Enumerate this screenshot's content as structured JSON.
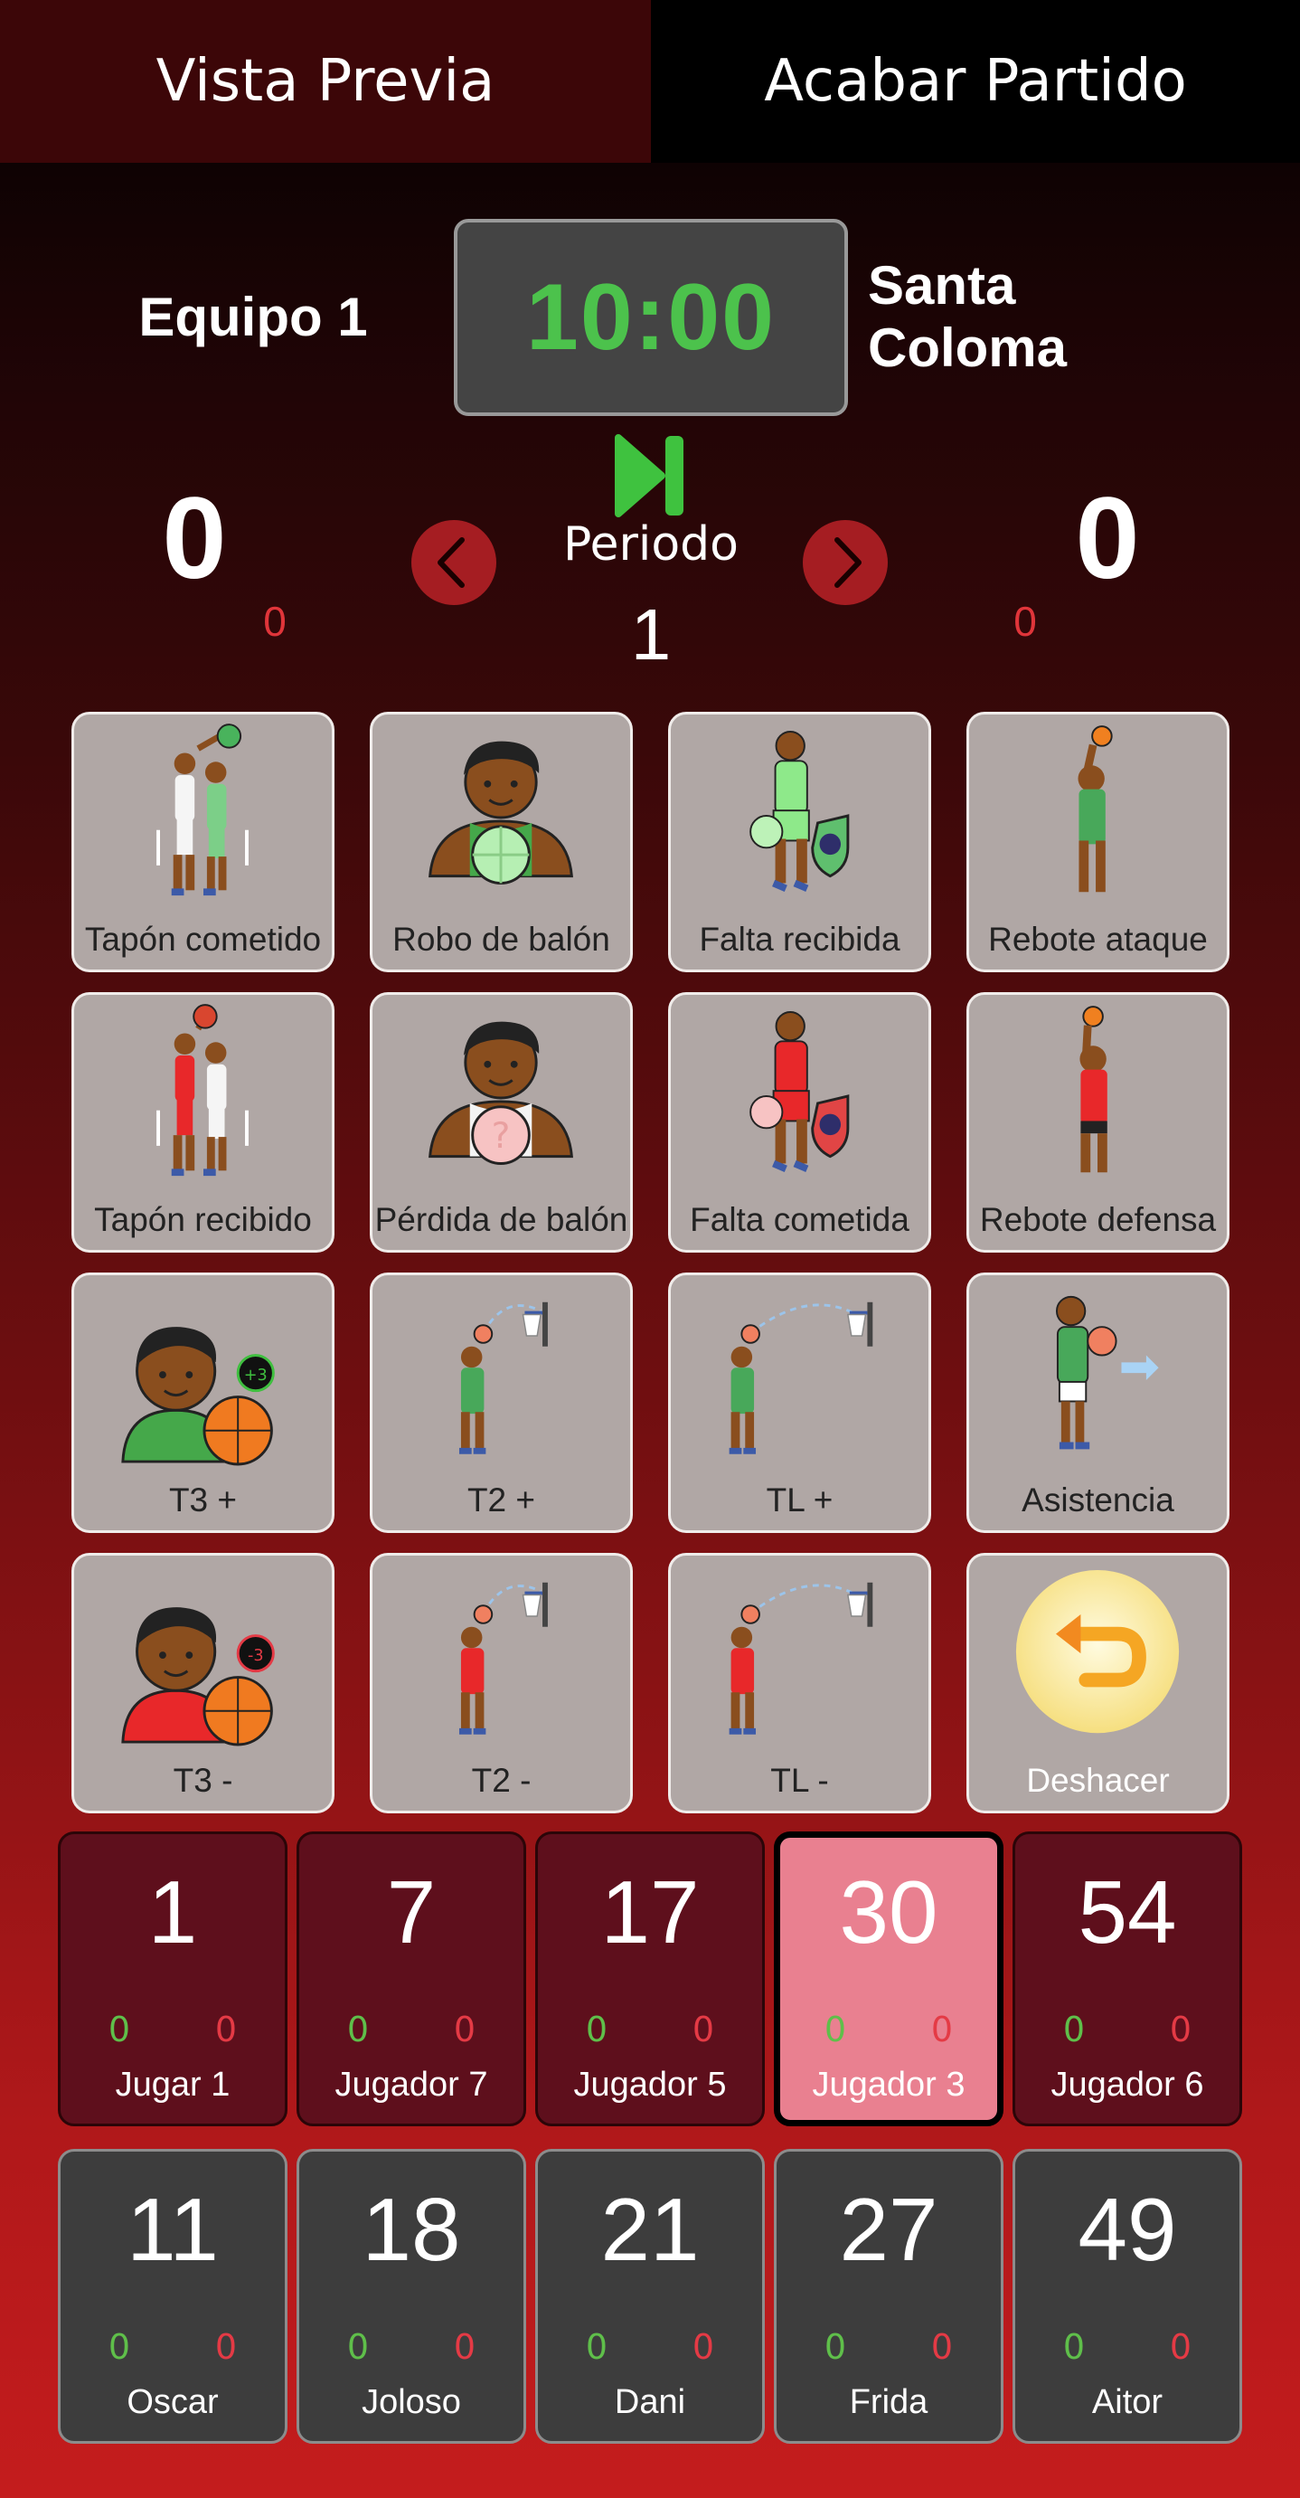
{
  "topbar": {
    "preview_label": "Vista Previa",
    "finish_label": "Acabar Partido"
  },
  "colors": {
    "clock": "#4cc24c",
    "accent_red": "#a51d22",
    "selected_player": "#e98090"
  },
  "match": {
    "home_team": "Equipo 1",
    "away_team": "Santa Coloma",
    "clock": "10:00",
    "home_score": "0",
    "away_score": "0",
    "home_fouls": "0",
    "away_fouls": "0",
    "period_label": "Periodo",
    "period": "1"
  },
  "actions": [
    {
      "label": "Tapón cometido",
      "icon": "block-made-icon"
    },
    {
      "label": "Robo de balón",
      "icon": "steal-icon"
    },
    {
      "label": "Falta recibida",
      "icon": "foul-received-icon"
    },
    {
      "label": "Rebote ataque",
      "icon": "offensive-rebound-icon"
    },
    {
      "label": "Tapón recibido",
      "icon": "block-received-icon"
    },
    {
      "label": "Pérdida de balón",
      "icon": "turnover-icon"
    },
    {
      "label": "Falta cometida",
      "icon": "foul-committed-icon"
    },
    {
      "label": "Rebote defensa",
      "icon": "defensive-rebound-icon"
    },
    {
      "label": "T3 +",
      "icon": "three-made-icon"
    },
    {
      "label": "T2 +",
      "icon": "two-made-icon"
    },
    {
      "label": "TL +",
      "icon": "free-throw-made-icon"
    },
    {
      "label": "Asistencia",
      "icon": "assist-icon"
    },
    {
      "label": "T3 -",
      "icon": "three-missed-icon"
    },
    {
      "label": "T2 -",
      "icon": "two-missed-icon"
    },
    {
      "label": "TL -",
      "icon": "free-throw-missed-icon"
    },
    {
      "label": "Deshacer",
      "icon": "undo-icon"
    }
  ],
  "players_on_court": [
    {
      "number": "1",
      "name": "Jugar 1",
      "good": "0",
      "bad": "0"
    },
    {
      "number": "7",
      "name": "Jugador 7",
      "good": "0",
      "bad": "0"
    },
    {
      "number": "17",
      "name": "Jugador 5",
      "good": "0",
      "bad": "0"
    },
    {
      "number": "30",
      "name": "Jugador 3",
      "good": "0",
      "bad": "0",
      "selected": true
    },
    {
      "number": "54",
      "name": "Jugador 6",
      "good": "0",
      "bad": "0"
    }
  ],
  "players_bench": [
    {
      "number": "11",
      "name": "Oscar",
      "good": "0",
      "bad": "0"
    },
    {
      "number": "18",
      "name": "Joloso",
      "good": "0",
      "bad": "0"
    },
    {
      "number": "21",
      "name": "Dani",
      "good": "0",
      "bad": "0"
    },
    {
      "number": "27",
      "name": "Frida",
      "good": "0",
      "bad": "0"
    },
    {
      "number": "49",
      "name": "Aitor",
      "good": "0",
      "bad": "0"
    }
  ]
}
